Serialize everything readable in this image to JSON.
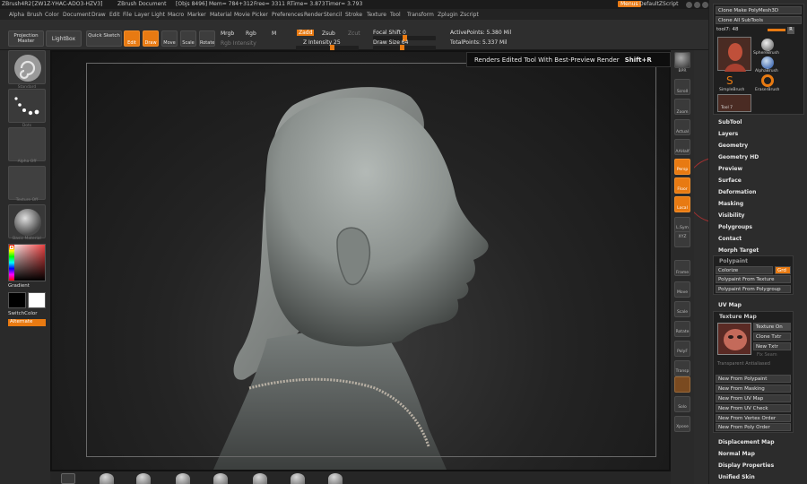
{
  "titlebar": {
    "app": "ZBrush4R2",
    "build": "[ZW1Z-YHAC-ADO3-HZV3]",
    "doc": "ZBrush Document",
    "obj": "[Objs 8496]",
    "mem": "Mem= 784+312",
    "free": "Free= 3311",
    "rtime": "RTime= 3.873",
    "timer": "Timer= 3.793",
    "menus_btn": "Menus",
    "default_zscript": "DefaultZScript"
  },
  "menubar": [
    "Alpha",
    "Brush",
    "Color",
    "Document",
    "Draw",
    "Edit",
    "File",
    "Layer",
    "Light",
    "Macro",
    "Marker",
    "Material",
    "Movie",
    "Picker",
    "Preferences",
    "Render",
    "Stencil",
    "Stroke",
    "Texture",
    "Tool",
    "Transform",
    "Zplugin",
    "Zscript"
  ],
  "toolbar": {
    "projection_master": "Projection Master",
    "lightbox": "LightBox",
    "quick_sketch": "Quick Sketch",
    "edit": "Edit",
    "draw": "Draw",
    "move": "Move",
    "scale": "Scale",
    "rotate": "Rotate",
    "mrgb": "Mrgb",
    "rgb": "Rgb",
    "m": "M",
    "rgb_intensity": "Rgb Intensity",
    "zadd": "Zadd",
    "zsub": "Zsub",
    "zcut": "Zcut",
    "z_intensity": "Z Intensity 25",
    "focal_shift": "Focal Shift 0",
    "draw_size": "Draw Size 64",
    "active_points": "ActivePoints: 5.380 Mil",
    "total_points": "TotalPoints: 5.337 Mil"
  },
  "left_shelf": {
    "standard_label": "Standard",
    "dots_label": "Dots",
    "alpha_label": "Alpha Off",
    "texture_label": "Texture Off",
    "material_label": "Basic Material",
    "gradient": "Gradient",
    "switch_color": "SwitchColor",
    "alternate": "Alternate"
  },
  "tooltip": {
    "text": "Renders Edited Tool With Best-Preview Render",
    "shortcut": "Shift+R"
  },
  "right_shelf": {
    "labels": [
      "BPR",
      "Scroll",
      "Zoom",
      "Actual",
      "AAHalf",
      "Persp",
      "Floor",
      "Local",
      "L.Sym",
      "XYZ",
      "",
      "Frame",
      "Move",
      "Scale",
      "Rotate",
      "PolyF",
      "Transp",
      "",
      "Solo",
      "Xpose"
    ]
  },
  "tray": {
    "clone_make": "Clone  Make PolyMesh3D",
    "clone_all": "Clone All SubTools",
    "tool_num": "tool7: 48",
    "r_btn": "R",
    "sphere_brush": "SphereBrush",
    "alpha_brush": "AlphaBrush",
    "simple_brush": "SimpleBrush",
    "eraser_brush": "EraserBrush",
    "tool7": "Tool 7",
    "items": [
      "SubTool",
      "Layers",
      "Geometry",
      "Geometry HD",
      "Preview",
      "Surface",
      "Deformation",
      "Masking",
      "Visibility",
      "Polygroups",
      "Contact",
      "Morph Target"
    ],
    "polypaint": "Polypaint",
    "colorize": "Colorize",
    "grd": "Grd",
    "polypaint_from_texture": "Polypaint From Texture",
    "polypaint_from_polygroup": "Polypaint From Polygroup",
    "uv_map": "UV Map",
    "texture_map": "Texture Map",
    "texture_on": "Texture On",
    "clone_txtr": "Clone Txtr",
    "new_txtr": "New Txtr",
    "fix_seam": "Fix Seam",
    "transparent": "Transparent  Antialiased",
    "new_btns": [
      "New From Polypaint",
      "New From Masking",
      "New From UV Map",
      "New From UV Check",
      "New From Vertex Order",
      "New From Poly Order"
    ],
    "bottom_items": [
      "Displacement Map",
      "Normal Map",
      "Display Properties",
      "Unified Skin"
    ]
  },
  "colors": {
    "accent": "#e87a12",
    "panel_bg": "#2c2c2c",
    "viewport_bg": "#1a1a1a"
  }
}
